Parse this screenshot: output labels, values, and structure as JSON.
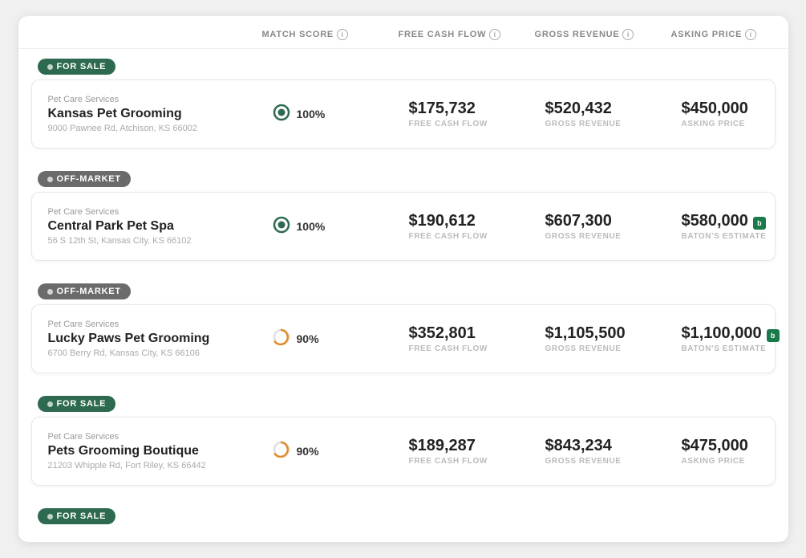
{
  "header": {
    "cols": [
      {
        "id": "match",
        "label": "MATCH SCORE"
      },
      {
        "id": "fcf",
        "label": "FREE CASH FLOW"
      },
      {
        "id": "gross",
        "label": "GROSS REVENUE"
      },
      {
        "id": "asking",
        "label": "ASKING PRICE"
      }
    ]
  },
  "listings": [
    {
      "id": "kansas-pet-grooming",
      "badge": "FOR SALE",
      "badge_type": "for-sale",
      "category": "Pet Care Services",
      "name": "Kansas Pet Grooming",
      "address": "9000 Pawnee Rd, Atchison, KS 66002",
      "match_score": "100%",
      "match_type": "green",
      "fcf_value": "$175,732",
      "fcf_label": "FREE CASH FLOW",
      "gross_value": "$520,432",
      "gross_label": "GROSS REVENUE",
      "asking_value": "$450,000",
      "asking_label": "ASKING PRICE",
      "asking_badge": false
    },
    {
      "id": "central-park-pet-spa",
      "badge": "OFF-MARKET",
      "badge_type": "off-market",
      "category": "Pet Care Services",
      "name": "Central Park Pet Spa",
      "address": "56 S 12th St, Kansas City, KS 66102",
      "match_score": "100%",
      "match_type": "green",
      "fcf_value": "$190,612",
      "fcf_label": "FREE CASH FLOW",
      "gross_value": "$607,300",
      "gross_label": "GROSS REVENUE",
      "asking_value": "$580,000",
      "asking_label": "BATON'S ESTIMATE",
      "asking_badge": true
    },
    {
      "id": "lucky-paws-pet-grooming",
      "badge": "OFF-MARKET",
      "badge_type": "off-market",
      "category": "Pet Care Services",
      "name": "Lucky Paws Pet Grooming",
      "address": "6700 Berry Rd, Kansas City, KS 66106",
      "match_score": "90%",
      "match_type": "orange",
      "fcf_value": "$352,801",
      "fcf_label": "FREE CASH FLOW",
      "gross_value": "$1,105,500",
      "gross_label": "GROSS REVENUE",
      "asking_value": "$1,100,000",
      "asking_label": "BATON'S ESTIMATE",
      "asking_badge": true
    },
    {
      "id": "pets-grooming-boutique",
      "badge": "FOR SALE",
      "badge_type": "for-sale",
      "category": "Pet Care Services",
      "name": "Pets Grooming Boutique",
      "address": "21203 Whipple Rd, Fort Riley, KS 66442",
      "match_score": "90%",
      "match_type": "orange",
      "fcf_value": "$189,287",
      "fcf_label": "FREE CASH FLOW",
      "gross_value": "$843,234",
      "gross_label": "GROSS REVENUE",
      "asking_value": "$475,000",
      "asking_label": "ASKING PRICE",
      "asking_badge": false
    },
    {
      "id": "listing-5",
      "badge": "FOR SALE",
      "badge_type": "for-sale",
      "show_card": false
    }
  ],
  "icons": {
    "info": "i",
    "for_sale_dot": "●",
    "off_market_dot": "●",
    "baton": "b"
  }
}
